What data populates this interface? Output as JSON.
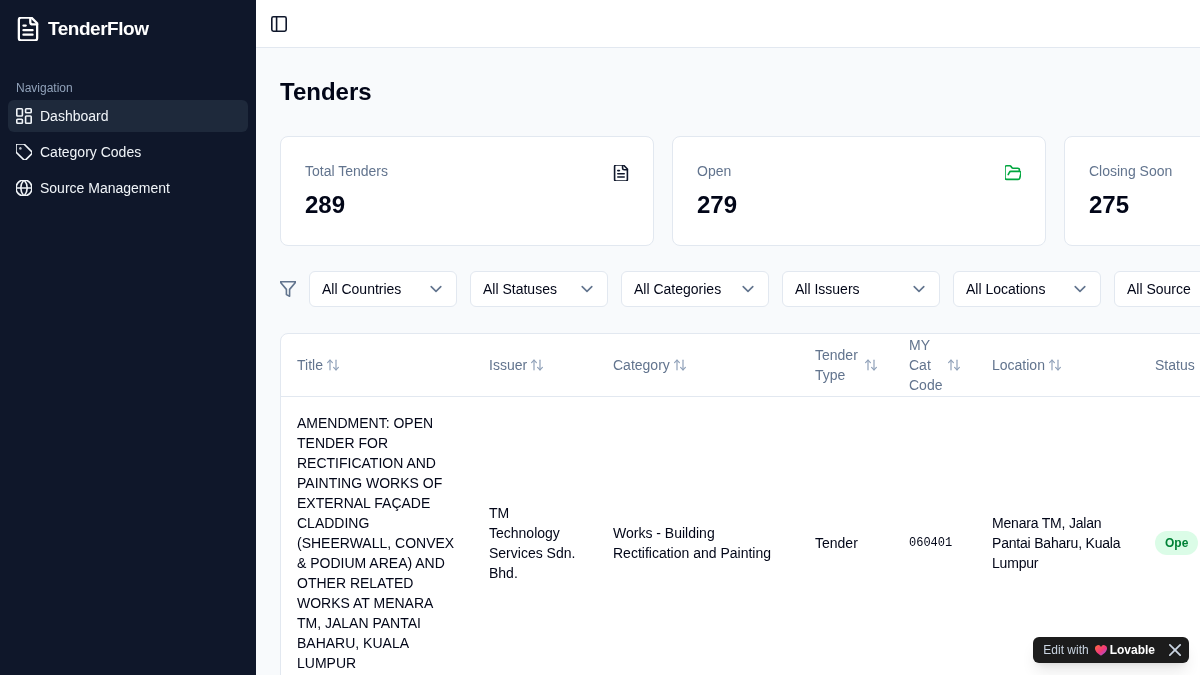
{
  "sidebar": {
    "brand": "TenderFlow",
    "section_label": "Navigation",
    "items": [
      {
        "label": "Dashboard",
        "selected": true
      },
      {
        "label": "Category Codes",
        "selected": false
      },
      {
        "label": "Source Management",
        "selected": false
      }
    ]
  },
  "page": {
    "title": "Tenders"
  },
  "stats": [
    {
      "label": "Total Tenders",
      "value": "289"
    },
    {
      "label": "Open",
      "value": "279"
    },
    {
      "label": "Closing Soon",
      "value": "275"
    }
  ],
  "filters": [
    "All Countries",
    "All Statuses",
    "All Categories",
    "All Issuers",
    "All Locations",
    "All Source"
  ],
  "table": {
    "columns": [
      {
        "label": "Title",
        "sortable": true
      },
      {
        "label": "Issuer",
        "sortable": true
      },
      {
        "label": "Category",
        "sortable": true
      },
      {
        "label": "Tender Type",
        "sortable": true
      },
      {
        "label": "MY Cat Code",
        "sortable": true
      },
      {
        "label": "Location",
        "sortable": true
      },
      {
        "label": "Status",
        "sortable": false
      }
    ],
    "rows": [
      {
        "title": "AMENDMENT: OPEN TENDER FOR RECTIFICATION AND PAINTING WORKS OF EXTERNAL FAÇADE CLADDING (SHEERWALL, CONVEX & PODIUM AREA) AND OTHER RELATED WORKS AT MENARA TM, JALAN PANTAI BAHARU, KUALA LUMPUR",
        "issuer": "TM Technology Services Sdn. Bhd.",
        "category": "Works - Building Rectification and Painting",
        "tender_type": "Tender",
        "my_cat_code": "060401",
        "location": "Menara TM, Jalan Pantai Baharu, Kuala Lumpur",
        "status": "Ope"
      }
    ]
  },
  "edit_badge": {
    "label": "Edit with",
    "brand": "Lovable"
  }
}
